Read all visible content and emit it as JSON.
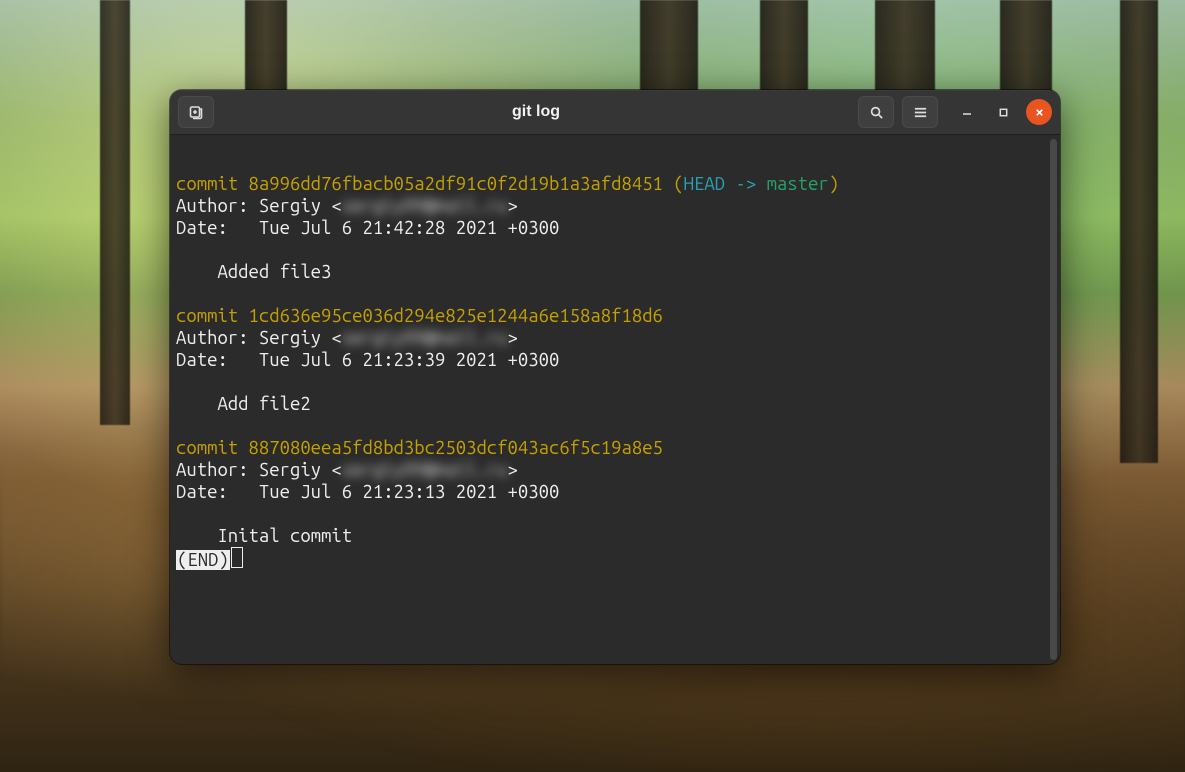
{
  "window": {
    "title": "git log"
  },
  "log": {
    "commit_word": "commit",
    "author_label": "Author:",
    "date_label": "Date:",
    "head_ref_open": " (",
    "head_label": "HEAD -> ",
    "branch": "master",
    "head_ref_close": ")",
    "commits": [
      {
        "hash": "8a996dd76fbacb05a2df91c0f2d19b1a3afd8451",
        "is_head": true,
        "author_name": "Sergiy",
        "author_email_masked": "sergiy99@mail.ru",
        "date": "Tue Jul 6 21:42:28 2021 +0300",
        "message": "Added file3"
      },
      {
        "hash": "1cd636e95ce036d294e825e1244a6e158a8f18d6",
        "is_head": false,
        "author_name": "Sergiy",
        "author_email_masked": "sergiy99@mail.ru",
        "date": "Tue Jul 6 21:23:39 2021 +0300",
        "message": "Add file2"
      },
      {
        "hash": "887080eea5fd8bd3bc2503dcf043ac6f5c19a8e5",
        "is_head": false,
        "author_name": "Sergiy",
        "author_email_masked": "sergiy99@mail.ru",
        "date": "Tue Jul 6 21:23:13 2021 +0300",
        "message": "Inital commit"
      }
    ],
    "end_marker": "(END)"
  }
}
